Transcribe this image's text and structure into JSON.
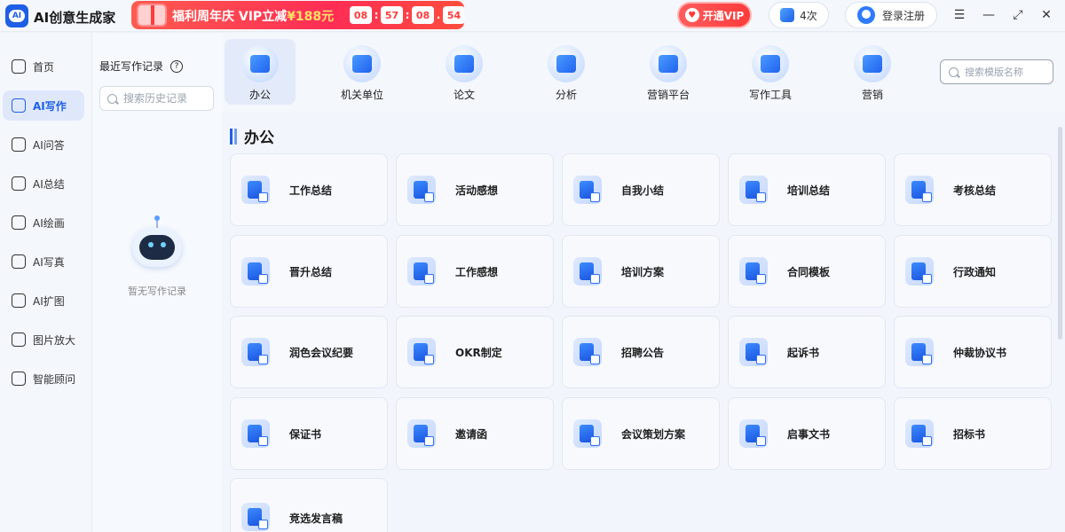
{
  "app": {
    "title": "AI创意生成家",
    "logo_text": "AI"
  },
  "promo": {
    "label": "福利周年庆  VIP立减",
    "amount": "¥188元",
    "countdown": [
      "08",
      "57",
      "08",
      "54"
    ]
  },
  "header": {
    "vip_button": "开通VIP",
    "credits": "4次",
    "login": "登录注册",
    "icons": [
      "menu-icon",
      "minimize-icon",
      "maximize-icon",
      "close-icon"
    ]
  },
  "nav": {
    "items": [
      {
        "label": "首页",
        "icon": "home-icon",
        "active": false
      },
      {
        "label": "AI写作",
        "icon": "pen-icon",
        "active": true
      },
      {
        "label": "AI问答",
        "icon": "chat-icon",
        "active": false
      },
      {
        "label": "AI总结",
        "icon": "document-icon",
        "active": false
      },
      {
        "label": "AI绘画",
        "icon": "brush-icon",
        "active": false
      },
      {
        "label": "AI写真",
        "icon": "portrait-icon",
        "active": false
      },
      {
        "label": "AI扩图",
        "icon": "expand-icon",
        "active": false
      },
      {
        "label": "图片放大",
        "icon": "zoom-image-icon",
        "active": false
      },
      {
        "label": "智能顾问",
        "icon": "robot-icon",
        "active": false
      }
    ]
  },
  "history": {
    "title": "最近写作记录",
    "search_placeholder": "搜索历史记录",
    "empty_text": "暂无写作记录"
  },
  "categories": {
    "items": [
      {
        "label": "办公",
        "active": true
      },
      {
        "label": "机关单位",
        "active": false
      },
      {
        "label": "论文",
        "active": false
      },
      {
        "label": "分析",
        "active": false
      },
      {
        "label": "营销平台",
        "active": false
      },
      {
        "label": "写作工具",
        "active": false
      },
      {
        "label": "营销",
        "active": false
      }
    ],
    "search_placeholder": "搜索模版名称"
  },
  "main": {
    "section_title": "办公",
    "templates": [
      "工作总结",
      "活动感想",
      "自我小结",
      "培训总结",
      "考核总结",
      "晋升总结",
      "工作感想",
      "培训方案",
      "合同模板",
      "行政通知",
      "润色会议纪要",
      "OKR制定",
      "招聘公告",
      "起诉书",
      "仲裁协议书",
      "保证书",
      "邀请函",
      "会议策划方案",
      "启事文书",
      "招标书",
      "竞选发言稿"
    ]
  },
  "colors": {
    "accent": "#1f5fe6",
    "promo": "#ff2d55",
    "vip": "#ff3b3b",
    "background": "#eef3fb"
  }
}
